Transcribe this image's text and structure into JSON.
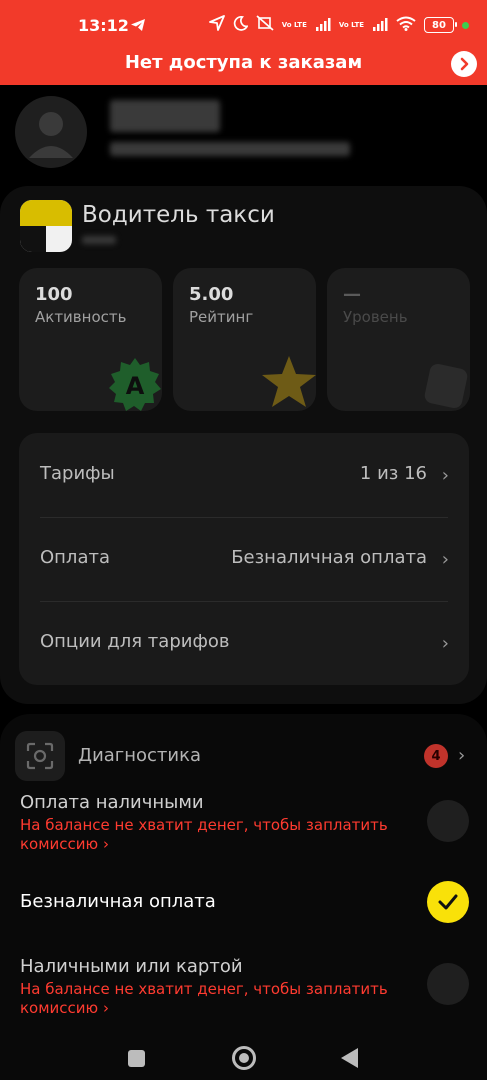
{
  "status_bar": {
    "time": "13:12",
    "net1": "Vo LTE",
    "net2": "Vo LTE",
    "battery": "80",
    "icons": [
      "telegram-icon",
      "location-icon",
      "moon-icon",
      "mute-icon",
      "signal-icon",
      "wifi-icon",
      "battery-icon"
    ]
  },
  "banner": {
    "text": "Нет доступа к заказам"
  },
  "profile": {
    "role_title": "Водитель такси",
    "stats": [
      {
        "value": "100",
        "label": "Активность",
        "badge_letter": "A"
      },
      {
        "value": "5.00",
        "label": "Рейтинг"
      },
      {
        "value": "—",
        "label": "Уровень"
      }
    ]
  },
  "settings": {
    "rows": [
      {
        "label": "Тарифы",
        "value": "1 из 16"
      },
      {
        "label": "Оплата",
        "value": "Безналичная оплата"
      },
      {
        "label": "Опции для тарифов",
        "value": ""
      }
    ]
  },
  "diagnostics": {
    "label": "Диагностика",
    "count": "4"
  },
  "payment_sheet": {
    "options": [
      {
        "title": "Оплата наличными",
        "warning": "На балансе не хватит денег, чтобы заплатить комиссию",
        "more": "›",
        "selected": false
      },
      {
        "title": "Безналичная оплата",
        "warning": "",
        "more": "",
        "selected": true
      },
      {
        "title": "Наличными или картой",
        "warning": "На балансе не хватит денег, чтобы заплатить комиссию",
        "more": "›",
        "selected": false
      }
    ]
  },
  "colors": {
    "alert_red": "#f23a2a",
    "warning_text": "#ff3b30",
    "selected_yellow": "#f9e109",
    "background": "#000000"
  }
}
